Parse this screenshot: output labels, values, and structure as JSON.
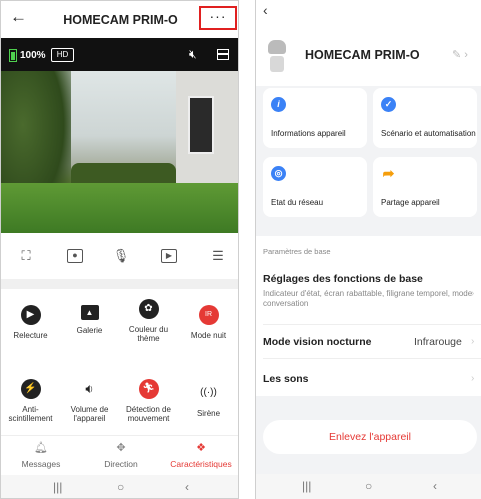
{
  "left": {
    "header": {
      "back_icon": "arrow-left-icon",
      "title": "HOMECAM PRIM-O",
      "more_label": "···"
    },
    "camera_status": {
      "battery_percent": "100%",
      "quality": "HD"
    },
    "features": [
      {
        "label": "Relecture",
        "icon": "play-icon",
        "color": "#222222"
      },
      {
        "label": "Galerie",
        "icon": "gallery-icon",
        "color": "#222222"
      },
      {
        "label": "Couleur du thème",
        "icon": "palette-icon",
        "color": "#222222"
      },
      {
        "label": "Mode nuit",
        "icon": "night-mode-ir-icon",
        "color": "#e53935"
      },
      {
        "label": "Anti-scintillement",
        "icon": "anti-flicker-icon",
        "color": "#222222"
      },
      {
        "label": "Volume de l'appareil",
        "icon": "volume-icon",
        "color": "#222222"
      },
      {
        "label": "Détection de mouvement",
        "icon": "motion-detection-icon",
        "color": "#e53935"
      },
      {
        "label": "Sirène",
        "icon": "siren-icon",
        "color": "#222222"
      }
    ],
    "bottom_nav": [
      {
        "label": "Messages",
        "icon": "bell-icon"
      },
      {
        "label": "Direction",
        "icon": "direction-pad-icon"
      },
      {
        "label": "Caractéristiques",
        "icon": "features-icon",
        "active": true
      }
    ],
    "accent_color": "#e53935"
  },
  "right": {
    "header": {
      "back_icon": "chevron-left-icon",
      "title": "HOMECAM PRIM-O",
      "edit_icon": "pencil-icon"
    },
    "cards": [
      {
        "label": "Informations appareil",
        "icon": "info-icon",
        "color": "#3b82f6"
      },
      {
        "label": "Scénario et automatisation",
        "icon": "check-shield-icon",
        "color": "#3b82f6"
      },
      {
        "label": "Etat du réseau",
        "icon": "network-icon",
        "color": "#3b82f6"
      },
      {
        "label": "Partage appareil",
        "icon": "share-arrow-icon",
        "color": "#f59e0b"
      }
    ],
    "section_label": "Paramètres de base",
    "basic_settings": {
      "title": "Réglages des fonctions de base",
      "subtitle": "Indicateur d'état, écran rabattable, filigrane temporel, mode conversation"
    },
    "night_vision": {
      "label": "Mode vision nocturne",
      "value": "Infrarouge"
    },
    "sounds": {
      "label": "Les sons"
    },
    "remove_button": "Enlevez l'appareil"
  },
  "system_nav": {
    "recent": "|||",
    "home": "○",
    "back": "‹"
  }
}
